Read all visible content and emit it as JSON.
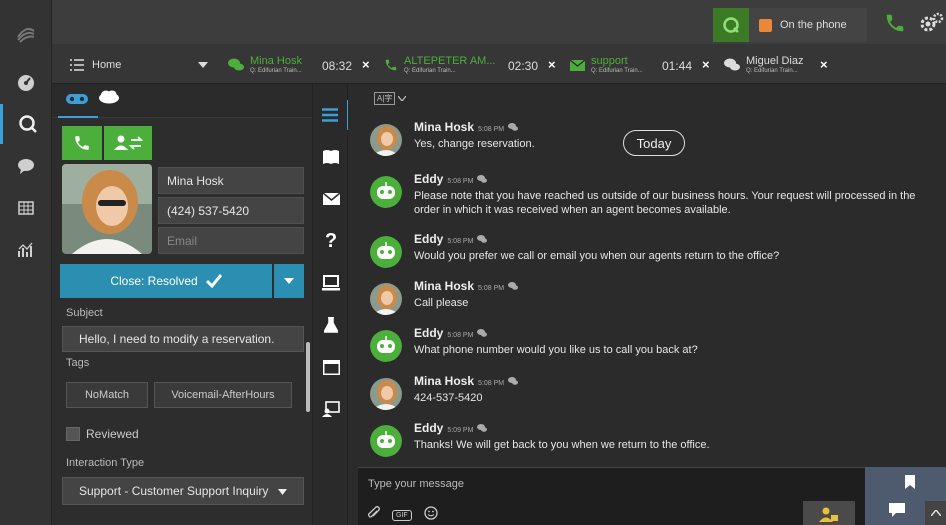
{
  "topbar": {
    "status_label": "On the phone",
    "colors": {
      "status_orange": "#e8883a",
      "accent_green": "#4caf3b",
      "accent_blue": "#3aa0d8"
    }
  },
  "tabs": [
    {
      "title": "Home",
      "icon": "list-icon"
    },
    {
      "title": "Mina Hosk",
      "sub": "Q: Edifurian Train...",
      "timer": "08:32",
      "icon": "chat-bubbles-icon"
    },
    {
      "title": "ALTEPETER AM...",
      "sub": "Q: Edifurian Train...",
      "timer": "02:30",
      "icon": "phone-icon"
    },
    {
      "title": "support",
      "sub": "Q: Edifurian Train...",
      "timer": "01:44",
      "icon": "email-icon"
    },
    {
      "title": "Miguel Diaz",
      "sub": "Q: Edifurian Train...",
      "icon": "chat-bubbles-icon"
    }
  ],
  "contact": {
    "name": "Mina Hosk",
    "phone": "(424) 537-5420",
    "email_placeholder": "Email",
    "close_label": "Close: Resolved",
    "subject_label": "Subject",
    "subject": "Hello, I need to modify a reservation.",
    "tags_label": "Tags",
    "tags": [
      "NoMatch",
      "Voicemail-AfterHours"
    ],
    "reviewed_label": "Reviewed",
    "interaction_type_label": "Interaction Type",
    "interaction_type": "Support - Customer Support Inquiry"
  },
  "chat": {
    "today_label": "Today",
    "messages": [
      {
        "sender": "Mina Hosk",
        "time": "5:08 PM",
        "text": "Yes, change reservation.",
        "type": "customer"
      },
      {
        "sender": "Eddy",
        "time": "5:08 PM",
        "text": "Please note that you have reached us outside of our business hours. Your request will processed in the order in which it was received when an agent becomes available.",
        "type": "bot"
      },
      {
        "sender": "Eddy",
        "time": "5:08 PM",
        "text": "Would you prefer we call or email you when our agents return to the office?",
        "type": "bot"
      },
      {
        "sender": "Mina Hosk",
        "time": "5:08 PM",
        "text": "Call please",
        "type": "customer"
      },
      {
        "sender": "Eddy",
        "time": "5:08 PM",
        "text": "What phone number would you like us to call you back at?",
        "type": "bot"
      },
      {
        "sender": "Mina Hosk",
        "time": "5:08 PM",
        "text": "424-537-5420",
        "type": "customer"
      },
      {
        "sender": "Eddy",
        "time": "5:09 PM",
        "text": "Thanks! We will get back to you when we return to the office.",
        "type": "bot"
      }
    ],
    "input_placeholder": "Type your message",
    "gif_label": "GIF"
  }
}
